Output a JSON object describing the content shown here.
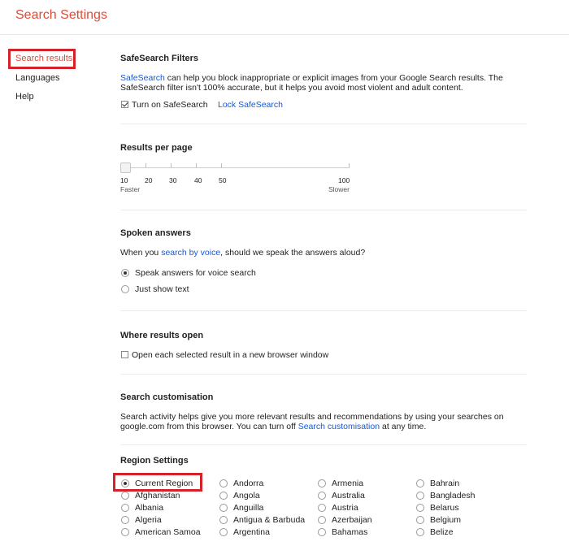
{
  "header": {
    "title": "Search Settings"
  },
  "sidebar": {
    "items": [
      {
        "label": "Search results"
      },
      {
        "label": "Languages"
      },
      {
        "label": "Help"
      }
    ]
  },
  "safesearch": {
    "title": "SafeSearch Filters",
    "link": "SafeSearch",
    "line1_rest": " can help you block inappropriate or explicit images from your Google Search results. The",
    "line2": "SafeSearch filter isn't 100% accurate, but it helps you avoid most violent and adult content.",
    "checkbox_label": "Turn on SafeSearch",
    "checkbox_checked": true,
    "lock_link": "Lock SafeSearch"
  },
  "results_per_page": {
    "title": "Results per page",
    "ticks": [
      "10",
      "20",
      "30",
      "40",
      "50",
      "100"
    ],
    "faster": "Faster",
    "slower": "Slower",
    "value": 10
  },
  "spoken": {
    "title": "Spoken answers",
    "text_pre": "When you ",
    "link": "search by voice",
    "text_post": ", should we speak the answers aloud?",
    "options": [
      {
        "label": "Speak answers for voice search",
        "selected": true
      },
      {
        "label": "Just show text",
        "selected": false
      }
    ]
  },
  "where_open": {
    "title": "Where results open",
    "checkbox_label": "Open each selected result in a new browser window",
    "checkbox_checked": false
  },
  "customisation": {
    "title": "Search customisation",
    "line1": "Search activity helps give you more relevant results and recommendations by using your searches on",
    "line2_pre": "google.com from this browser. You can turn off ",
    "link": "Search customisation",
    "line2_post": " at any time."
  },
  "region": {
    "title": "Region Settings",
    "columns": [
      [
        "Current Region",
        "Afghanistan",
        "Albania",
        "Algeria",
        "American Samoa"
      ],
      [
        "Andorra",
        "Angola",
        "Anguilla",
        "Antigua & Barbuda",
        "Argentina"
      ],
      [
        "Armenia",
        "Australia",
        "Austria",
        "Azerbaijan",
        "Bahamas"
      ],
      [
        "Bahrain",
        "Bangladesh",
        "Belarus",
        "Belgium",
        "Belize"
      ]
    ],
    "selected": "Current Region"
  },
  "colors": {
    "title": "#dd4b39",
    "highlight": "#d2232a",
    "link": "#1a0dab"
  }
}
